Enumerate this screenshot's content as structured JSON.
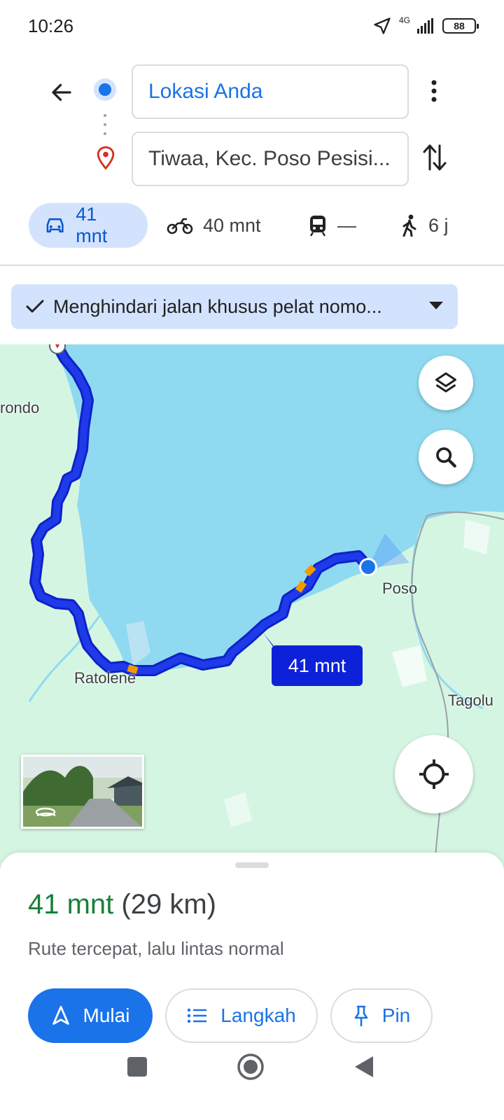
{
  "status_bar": {
    "time": "10:26",
    "network": "4G",
    "battery": "88"
  },
  "directions": {
    "origin": "Lokasi Anda",
    "destination": "Tiwaa, Kec. Poso Pesisi..."
  },
  "modes": [
    {
      "name": "car",
      "label": "41 mnt",
      "active": true
    },
    {
      "name": "motorcycle",
      "label": "40 mnt",
      "active": false
    },
    {
      "name": "transit",
      "label": "—",
      "active": false
    },
    {
      "name": "walk",
      "label": "6 j",
      "active": false
    }
  ],
  "filter": {
    "label": "Menghindari jalan khusus pelat nomo..."
  },
  "map": {
    "route_badge": "41 mnt",
    "labels": {
      "a": "rondo",
      "b": "Poso",
      "c": "Ratolene",
      "d": "Tagolu"
    }
  },
  "sheet": {
    "time": "41 mnt",
    "distance": "(29 km)",
    "description": "Rute tercepat, lalu lintas normal",
    "start_label": "Mulai",
    "steps_label": "Langkah",
    "pin_label": "Pin"
  },
  "colors": {
    "accent": "#1a73e8",
    "route": "#1f3ae8",
    "water": "#8fdaf0",
    "land": "#d5f5e3",
    "time_green": "#188038"
  }
}
